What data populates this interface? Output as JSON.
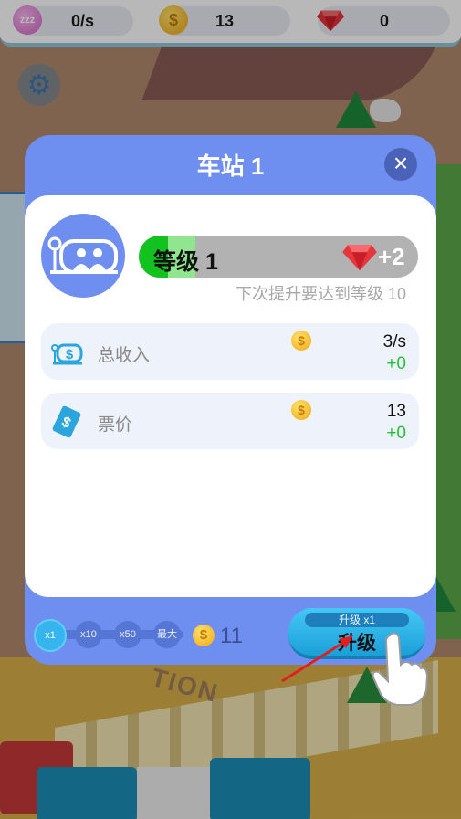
{
  "hud": {
    "income_rate": "0/s",
    "coins": "13",
    "gems": "0",
    "icons": [
      "sleep-icon",
      "coin-icon",
      "gem-icon"
    ]
  },
  "settings": {
    "icon": "gear-icon"
  },
  "dialog": {
    "title": "车站 1",
    "close_icon": "close-icon",
    "level": {
      "label": "等级 1",
      "bonus": "+2",
      "progress": 0.2,
      "next_hint": "下次提升要达到等级 10"
    },
    "stats": [
      {
        "label": "总收入",
        "value": "3/s",
        "delta": "+0",
        "icon": "income-icon"
      },
      {
        "label": "票价",
        "value": "13",
        "delta": "+0",
        "icon": "ticket-icon"
      }
    ],
    "multipliers": [
      "x1",
      "x10",
      "x50",
      "最大"
    ],
    "selected_multiplier": "x1",
    "cost": "11",
    "upgrade": {
      "sub_label": "升级 x1",
      "label": "升级"
    }
  },
  "world": {
    "sign_text": "TION"
  },
  "colors": {
    "dialog": "#6f8ff0",
    "level_fill": "#12c21f",
    "delta_green": "#23c23a",
    "upgrade_button": "#36b4ee"
  }
}
